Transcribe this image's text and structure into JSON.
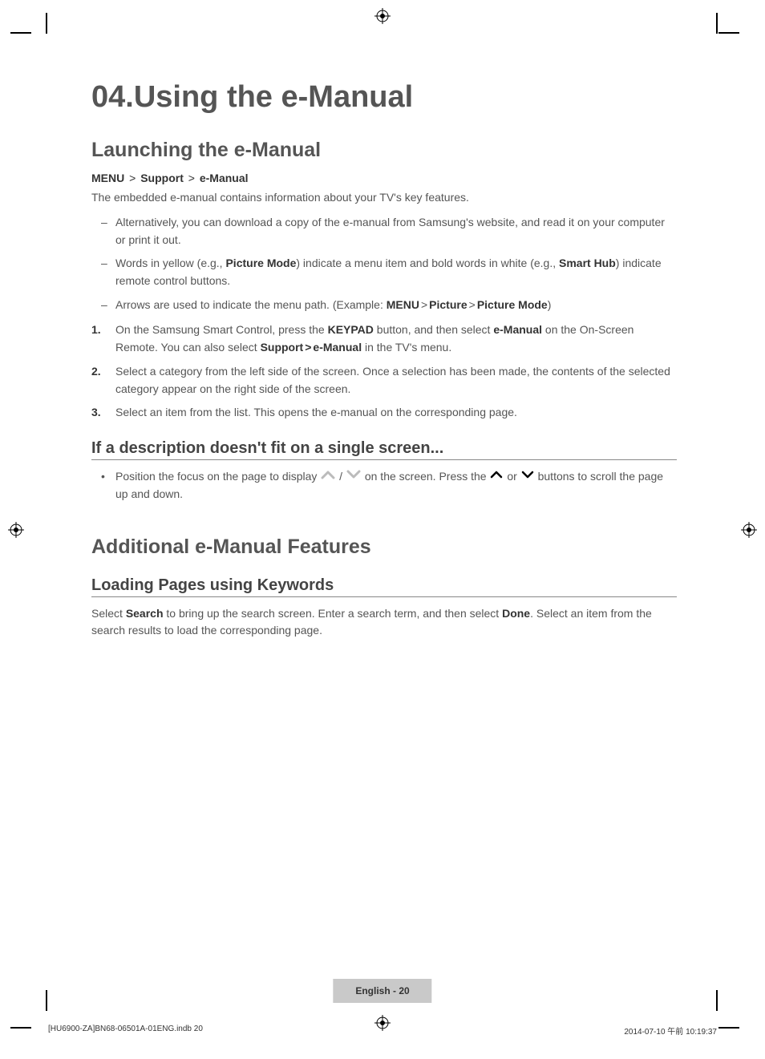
{
  "chapter_title": "04.Using the e-Manual",
  "section1": {
    "title": "Launching the e-Manual",
    "breadcrumb": [
      "MENU",
      "Support",
      "e-Manual"
    ],
    "intro": "The embedded e-manual contains information about your TV's key features.",
    "dash_items": [
      "Alternatively, you can download a copy of the e-manual from Samsung's website, and read it on your computer or print it out."
    ],
    "dash_item2_pre": "Words in yellow (e.g., ",
    "dash_item2_bold1": "Picture Mode",
    "dash_item2_mid": ") indicate a menu item and bold words in white (e.g., ",
    "dash_item2_bold2": "Smart Hub",
    "dash_item2_post": ") indicate remote control buttons.",
    "dash_item3_pre": "Arrows are used to indicate the menu path. (Example: ",
    "dash_item3_path": [
      "MENU",
      "Picture",
      "Picture Mode"
    ],
    "dash_item3_post": ")",
    "step1_a": "On the Samsung Smart Control, press the ",
    "step1_b1": "KEYPAD",
    "step1_b": " button, and then select ",
    "step1_b2": "e-Manual",
    "step1_c": " on the On-Screen Remote. You can also select ",
    "step1_b3": "Support",
    "step1_chev": " > ",
    "step1_b4": "e-Manual",
    "step1_d": " in the TV's menu.",
    "step2": "Select a category from the left side of the screen. Once a selection has been made, the contents of the selected category appear on the right side of the screen.",
    "step3": "Select an item from the list. This opens the e-manual on the corresponding page.",
    "sub1_title": "If a description doesn't fit on a single screen...",
    "sub1_item_a": "Position the focus on the page to display ",
    "sub1_item_b": " / ",
    "sub1_item_c": " on the screen. Press the ",
    "sub1_item_d": " or ",
    "sub1_item_e": " buttons to scroll the page up and down."
  },
  "section2": {
    "title": "Additional e-Manual Features",
    "sub1_title": "Loading Pages using Keywords",
    "sub1_para_a": "Select ",
    "sub1_para_b1": "Search",
    "sub1_para_b": " to bring up the search screen. Enter a search term, and then select ",
    "sub1_para_b2": "Done",
    "sub1_para_c": ". Select an item from the search results to load the corresponding page."
  },
  "footer": {
    "lang_page": "English - 20",
    "filename": "[HU6900-ZA]BN68-06501A-01ENG.indb   20",
    "datetime": "2014-07-10   午前 10:19:37"
  }
}
